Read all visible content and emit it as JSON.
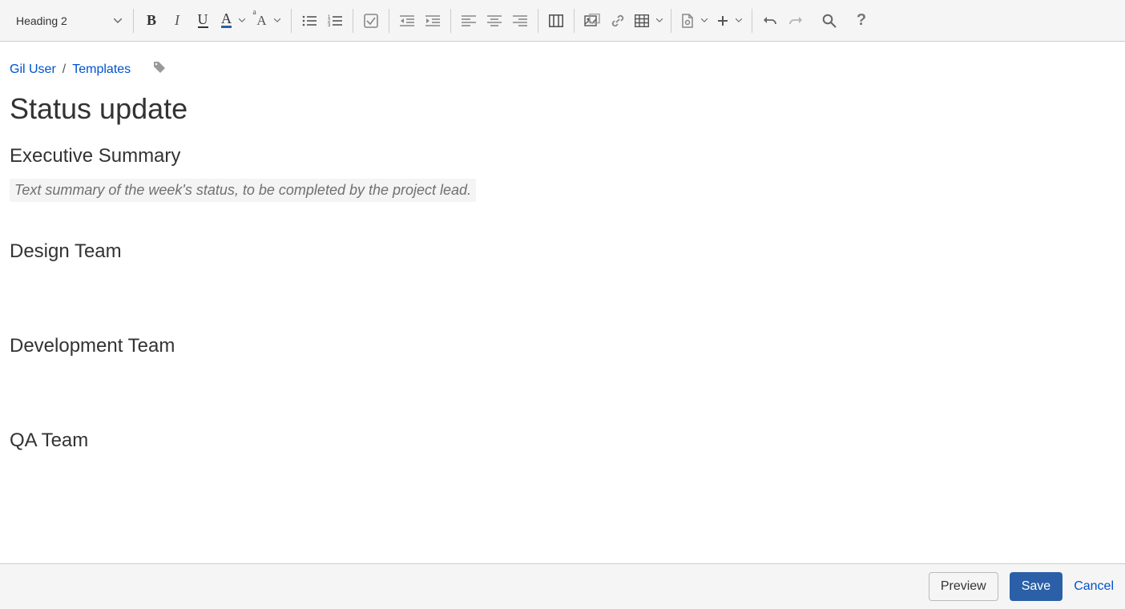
{
  "toolbar": {
    "style_select": "Heading 2"
  },
  "breadcrumb": {
    "items": [
      "Gil User",
      "Templates"
    ]
  },
  "page": {
    "title": "Status update",
    "sections": [
      {
        "heading": "Executive Summary",
        "placeholder": "Text summary of the week's status, to be completed by the project lead."
      },
      {
        "heading": "Design Team"
      },
      {
        "heading": "Development Team"
      },
      {
        "heading": "QA Team"
      }
    ]
  },
  "footer": {
    "preview": "Preview",
    "save": "Save",
    "cancel": "Cancel"
  }
}
